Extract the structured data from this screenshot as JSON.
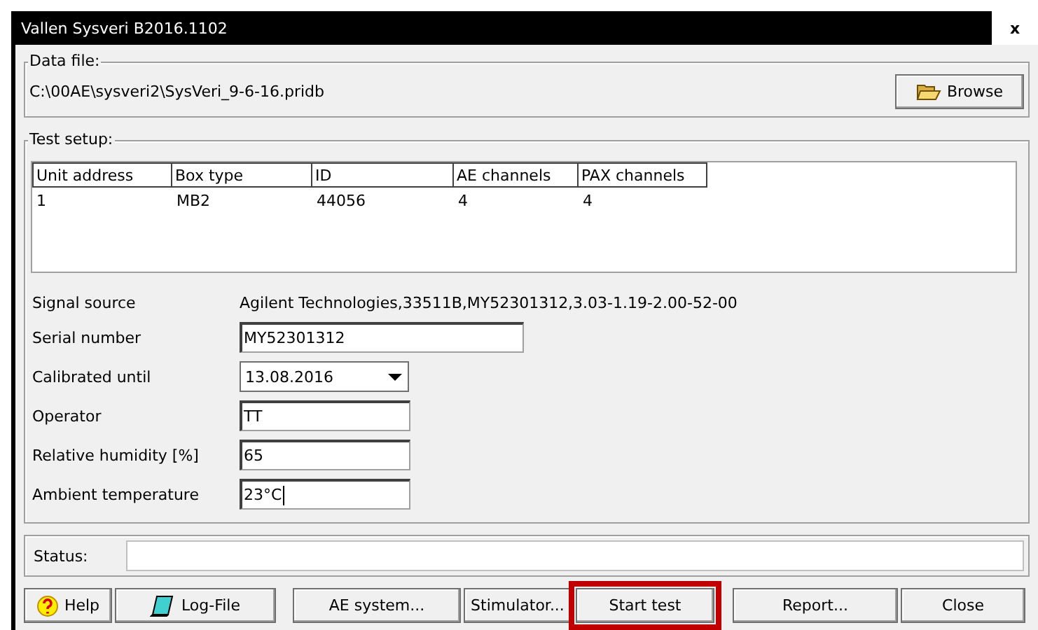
{
  "window": {
    "title": "Vallen Sysveri B2016.1102",
    "close": "x"
  },
  "data_file": {
    "legend": "Data file:",
    "path": "C:\\00AE\\sysveri2\\SysVeri_9-6-16.pridb",
    "browse": "Browse"
  },
  "test_setup": {
    "legend": "Test setup:",
    "table": {
      "columns": [
        "Unit address",
        "Box type",
        "ID",
        "AE channels",
        "PAX channels"
      ],
      "rows": [
        [
          "1",
          "MB2",
          "44056",
          "4",
          "4"
        ]
      ]
    },
    "signal_source": {
      "label": "Signal source",
      "value": "Agilent Technologies,33511B,MY52301312,3.03-1.19-2.00-52-00"
    },
    "fields": [
      {
        "kind": "text",
        "label": "Serial number",
        "value": "MY52301312"
      },
      {
        "kind": "dropdown",
        "label": "Calibrated until",
        "value": "13.08.2016"
      },
      {
        "kind": "text",
        "label": "Operator",
        "value": "TT"
      },
      {
        "kind": "text",
        "label": "Relative humidity [%]",
        "value": "65"
      },
      {
        "kind": "text",
        "label": "Ambient temperature",
        "value": "23°C",
        "focused": true
      }
    ]
  },
  "status": {
    "label": "Status:"
  },
  "buttons": [
    {
      "label": "Help",
      "highlighted": false
    },
    {
      "label": "Log-File",
      "highlighted": false
    },
    {
      "label": "AE system...",
      "highlighted": false
    },
    {
      "label": "Stimulator...",
      "highlighted": false
    },
    {
      "label": "Start test",
      "highlighted": true
    },
    {
      "label": "Report...",
      "highlighted": false
    },
    {
      "label": "Close",
      "highlighted": false
    }
  ]
}
